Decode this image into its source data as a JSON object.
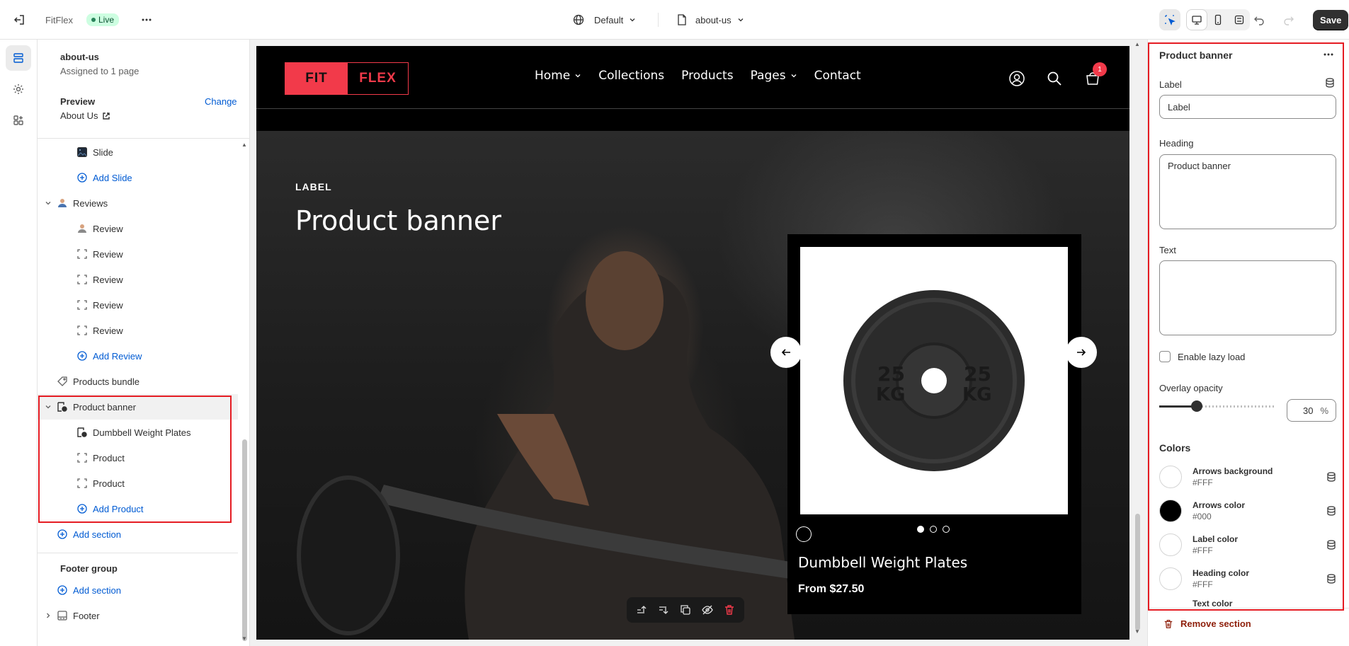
{
  "topbar": {
    "store_name": "FitFlex",
    "status": "Live",
    "theme_select": "Default",
    "template_select": "about-us",
    "save_label": "Save"
  },
  "left_panel": {
    "template_name": "about-us",
    "assigned": "Assigned to 1 page",
    "preview_label": "Preview",
    "preview_change": "Change",
    "preview_page": "About Us",
    "items": [
      {
        "label": "Slide",
        "icon": "image-icon"
      },
      {
        "label": "Add Slide",
        "icon": "plus-circle-icon"
      },
      {
        "label": "Reviews",
        "icon": "user-icon"
      },
      {
        "label": "Review",
        "icon": "user-icon"
      },
      {
        "label": "Review",
        "icon": "block-icon"
      },
      {
        "label": "Review",
        "icon": "block-icon"
      },
      {
        "label": "Review",
        "icon": "block-icon"
      },
      {
        "label": "Review",
        "icon": "block-icon"
      },
      {
        "label": "Add Review",
        "icon": "plus-circle-icon"
      },
      {
        "label": "Products bundle",
        "icon": "tag-icon"
      },
      {
        "label": "Product banner",
        "icon": "product-banner-icon"
      },
      {
        "label": "Dumbbell Weight Plates",
        "icon": "product-banner-icon"
      },
      {
        "label": "Product",
        "icon": "block-icon"
      },
      {
        "label": "Product",
        "icon": "block-icon"
      },
      {
        "label": "Add Product",
        "icon": "plus-circle-icon"
      }
    ],
    "add_section_1": "Add section",
    "footer_group": "Footer group",
    "add_section_2": "Add section",
    "footer": "Footer"
  },
  "preview": {
    "logo_left": "FIT",
    "logo_right": "FLEX",
    "nav": [
      "Home",
      "Collections",
      "Products",
      "Pages",
      "Contact"
    ],
    "cart_count": "1",
    "banner_label": "LABEL",
    "banner_heading": "Product banner",
    "product_title": "Dumbbell Weight Plates",
    "product_price": "From $27.50",
    "plate_text": "25 KG"
  },
  "settings": {
    "title": "Product banner",
    "label_label": "Label",
    "label_value": "Label",
    "heading_label": "Heading",
    "heading_value": "Product banner",
    "text_label": "Text",
    "lazy_label": "Enable lazy load",
    "overlay_label": "Overlay opacity",
    "overlay_value": "30",
    "overlay_unit": "%",
    "colors_title": "Colors",
    "colors": [
      {
        "name": "Arrows background",
        "value": "#FFF",
        "hex": "#FFFFFF"
      },
      {
        "name": "Arrows color",
        "value": "#000",
        "hex": "#000000"
      },
      {
        "name": "Label color",
        "value": "#FFF",
        "hex": "#FFFFFF"
      },
      {
        "name": "Heading color",
        "value": "#FFF",
        "hex": "#FFFFFF"
      },
      {
        "name": "Text color",
        "value": "",
        "hex": "#FFFFFF"
      }
    ],
    "remove_section": "Remove section"
  },
  "theme": {
    "brand_red": "#F23A4A",
    "link_blue": "#005BD3",
    "highlight_red": "#E51C23"
  }
}
